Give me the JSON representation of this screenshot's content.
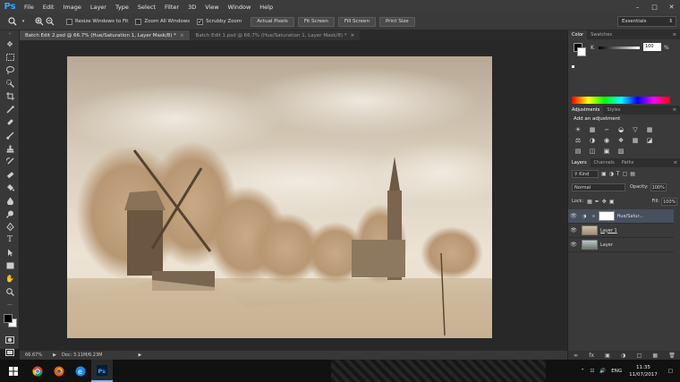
{
  "app": {
    "logo": "Ps",
    "menu": [
      "File",
      "Edit",
      "Image",
      "Layer",
      "Type",
      "Select",
      "Filter",
      "3D",
      "View",
      "Window",
      "Help"
    ],
    "window_controls": [
      "minimize",
      "restore",
      "close"
    ]
  },
  "options": {
    "checks": [
      {
        "label": "Resize Windows to Fit",
        "checked": false
      },
      {
        "label": "Zoom All Windows",
        "checked": false
      },
      {
        "label": "Scrubby Zoom",
        "checked": true
      }
    ],
    "buttons": [
      "Actual Pixels",
      "Fit Screen",
      "Fill Screen",
      "Print Size"
    ],
    "workspace": "Essentials"
  },
  "tabs": [
    {
      "label": "Batch Edit 2.psd @ 66.7% (Hue/Saturation 1, Layer Mask/8) *",
      "active": true
    },
    {
      "label": "Batch Edit 1.psd @ 66.7% (Hue/Saturation 1, Layer Mask/8) *",
      "active": false
    }
  ],
  "status": {
    "zoom": "66.67%",
    "doc": "Doc: 3.11M/6.23M"
  },
  "panels": {
    "color_tabs": [
      "Color",
      "Swatches"
    ],
    "k_label": "K",
    "k_value": "100",
    "k_unit": "%",
    "adjust_tabs": [
      "Adjustments",
      "Styles"
    ],
    "add_adjustment": "Add an adjustment",
    "layers_tabs": [
      "Layers",
      "Channels",
      "Paths"
    ],
    "kind": "Kind",
    "blend_mode": "Normal",
    "opacity_label": "Opacity:",
    "opacity_value": "100%",
    "lock_label": "Lock:",
    "fill_label": "Fill:",
    "fill_value": "100%",
    "layers": [
      {
        "name": "Hue/Satur...",
        "selected": true
      },
      {
        "name": "Layer 1",
        "selected": false
      },
      {
        "name": "Layer",
        "selected": false
      }
    ]
  },
  "taskbar": {
    "lang": "ENG",
    "time": "11:35",
    "date": "11/07/2017"
  }
}
